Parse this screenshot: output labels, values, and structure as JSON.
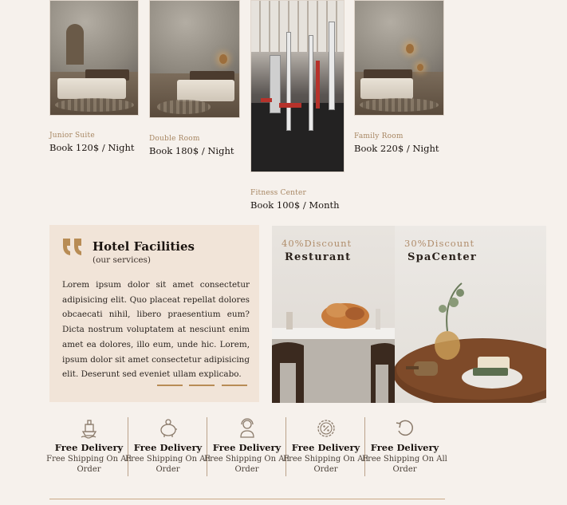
{
  "rooms": [
    {
      "name": "Junior Suite",
      "price": "Book 120$ / Night"
    },
    {
      "name": "Double Room",
      "price": "Book 180$ / Night"
    },
    {
      "name": "Fitness Center",
      "price": "Book 100$ / Month"
    },
    {
      "name": "Family Room",
      "price": "Book 220$ / Night"
    }
  ],
  "facilities": {
    "title": "Hotel Facilities",
    "subtitle": "(our services)",
    "body": "Lorem ipsum dolor sit amet consectetur adipisicing elit. Quo placeat repellat dolores obcaecati nihil, libero praesentium eum? Dicta nostrum voluptatem at nesciunt enim amet ea dolores, illo eum, unde hic. Lorem, ipsum dolor sit amet consectetur adipisicing elit. Deserunt sed eveniet ullam explicabo."
  },
  "promos": [
    {
      "discount": "40%Discount",
      "title": "Resturant"
    },
    {
      "discount": "30%Discount",
      "title": "SpaCenter"
    }
  ],
  "features": [
    {
      "icon": "ship-icon",
      "title": "Free Delivery",
      "desc": "Free Shipping On All Order"
    },
    {
      "icon": "piggy-bank-icon",
      "title": "Free Delivery",
      "desc": "Free Shipping On All Order"
    },
    {
      "icon": "support-agent-icon",
      "title": "Free Delivery",
      "desc": "Free Shipping On All Order"
    },
    {
      "icon": "percent-badge-icon",
      "title": "Free Delivery",
      "desc": "Free Shipping On All Order"
    },
    {
      "icon": "return-arrow-icon",
      "title": "Free Delivery",
      "desc": "Free Shipping On All Order"
    }
  ],
  "colors": {
    "background": "#f6f1ec",
    "accent": "#b88c55",
    "facilities_bg": "#f1e4d8"
  }
}
